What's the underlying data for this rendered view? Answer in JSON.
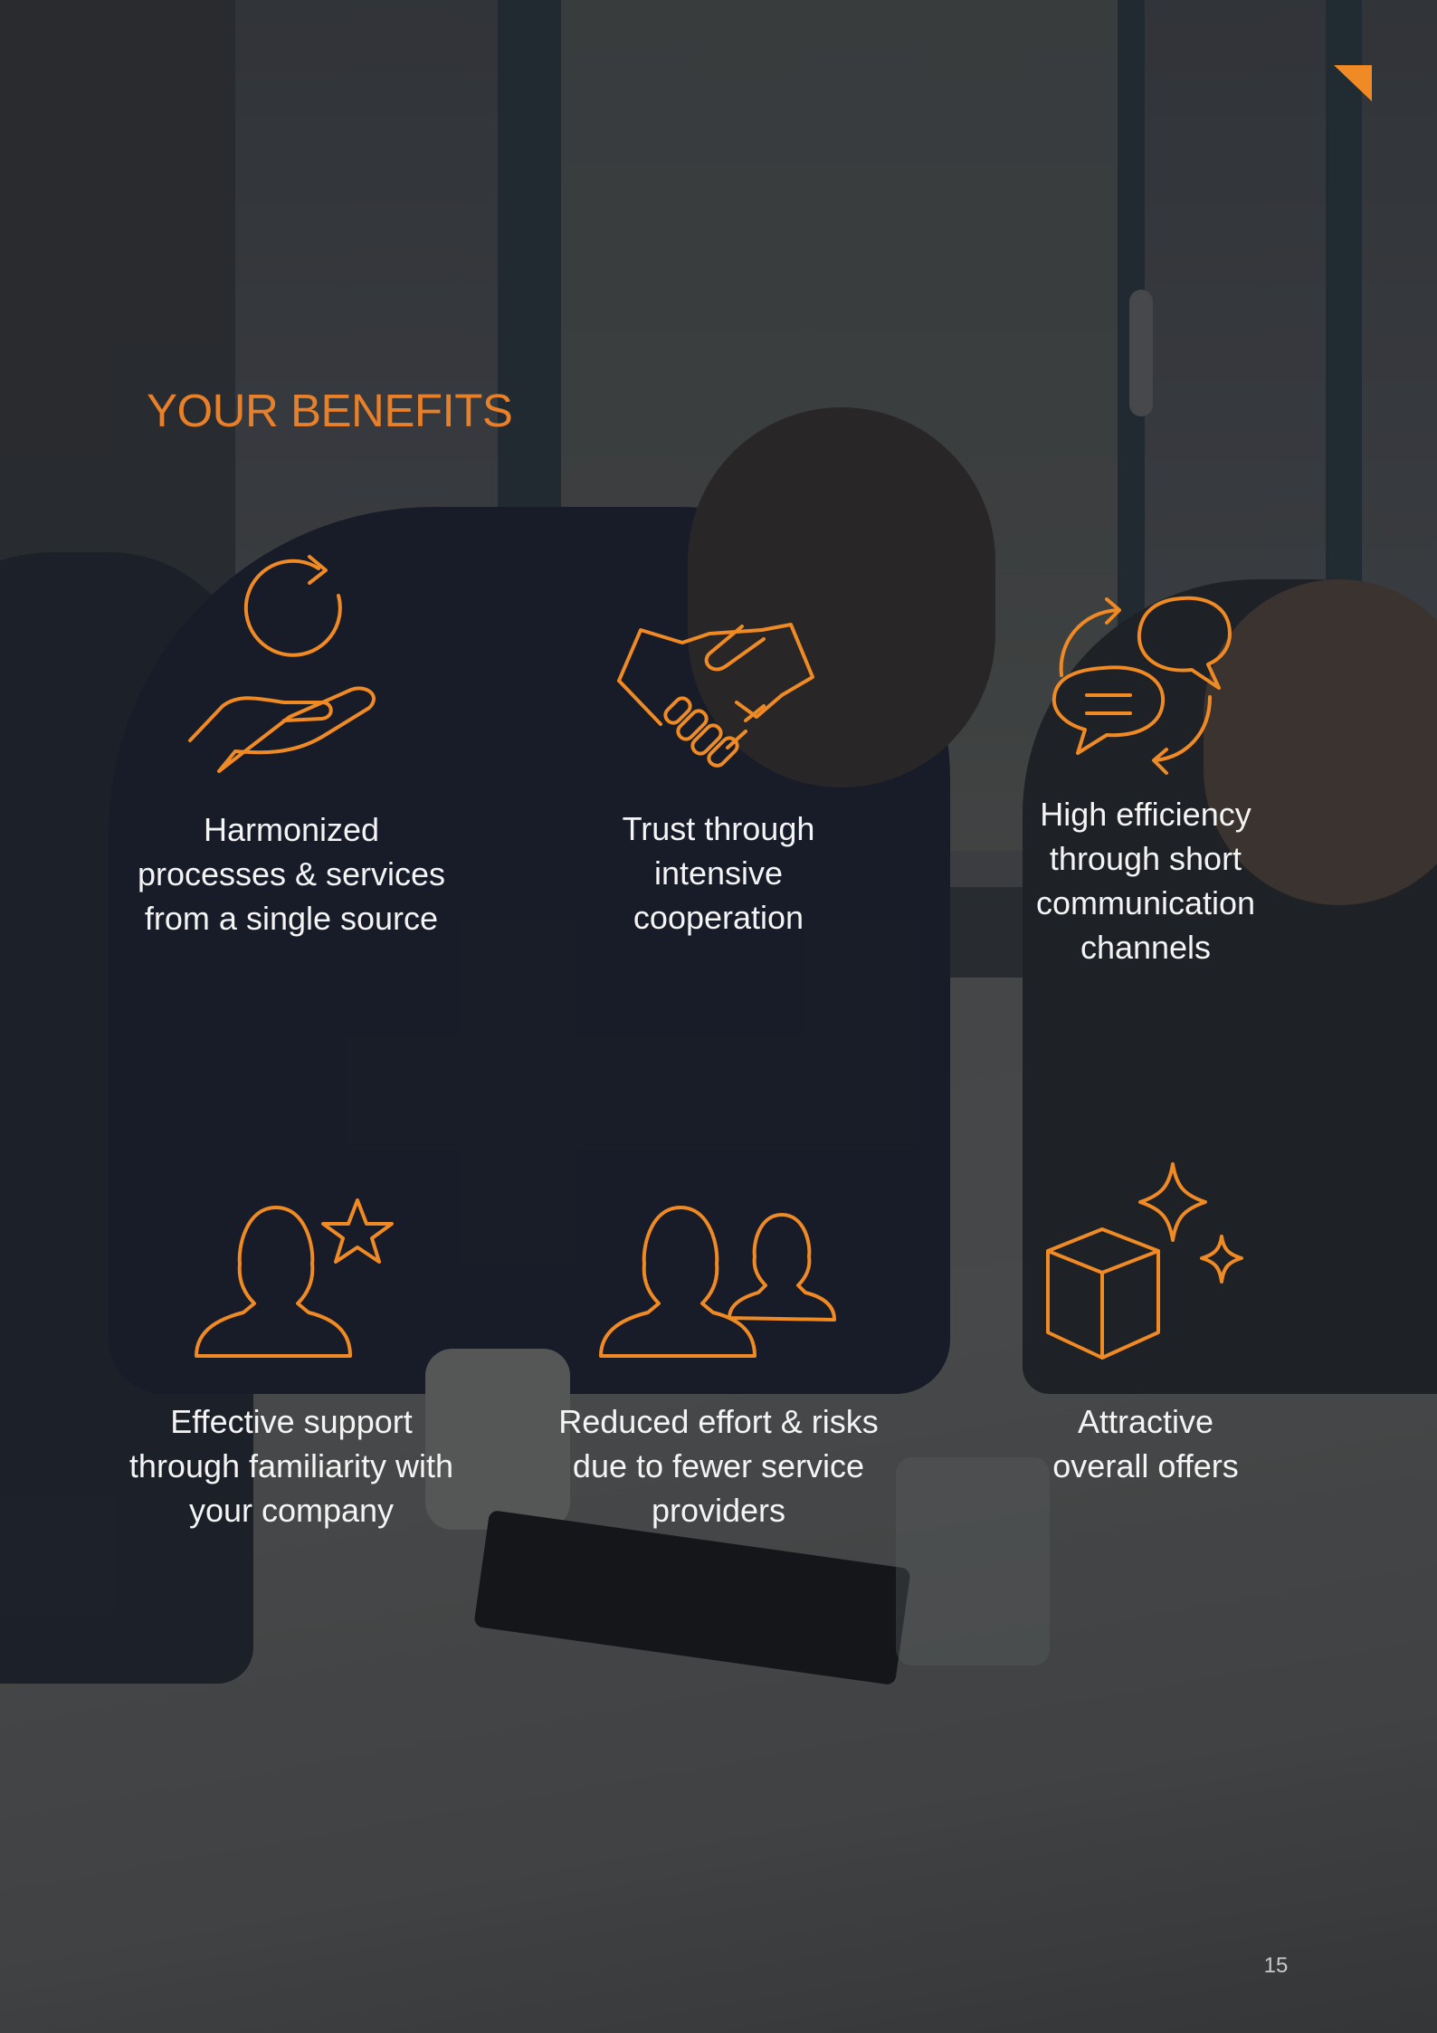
{
  "colors": {
    "accent": "#e8802a",
    "text": "#f4f4f4",
    "page_number": "#c9c9c9"
  },
  "header": {
    "title": "YOUR BENEFITS"
  },
  "benefits": [
    {
      "icon": "hand-with-refresh-icon",
      "lines": [
        "Harmonized",
        "processes & services",
        "from a single source"
      ]
    },
    {
      "icon": "handshake-icon",
      "lines": [
        "Trust through",
        "intensive",
        "cooperation"
      ]
    },
    {
      "icon": "chat-bubbles-icon",
      "lines": [
        "High efficiency",
        "through short",
        "communication",
        "channels"
      ]
    },
    {
      "icon": "person-with-star-icon",
      "lines": [
        "Effective support",
        "through familiarity with",
        "your company"
      ]
    },
    {
      "icon": "two-people-icon",
      "lines": [
        "Reduced effort & risks",
        "due to fewer service",
        "providers"
      ]
    },
    {
      "icon": "box-with-sparkles-icon",
      "lines": [
        "Attractive",
        "overall offers"
      ]
    }
  ],
  "footer": {
    "page_number": "15"
  }
}
